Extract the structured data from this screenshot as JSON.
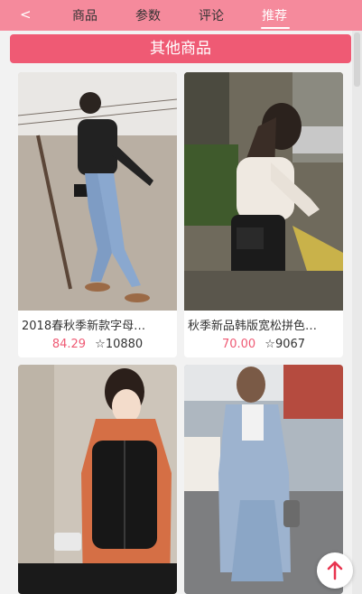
{
  "nav": {
    "back_label": "<",
    "tabs": [
      {
        "label": "商品"
      },
      {
        "label": "参数"
      },
      {
        "label": "评论"
      },
      {
        "label": "推荐",
        "active": true
      }
    ]
  },
  "section": {
    "title": "其他商品"
  },
  "products": [
    {
      "name": "2018春秋季新款字母…",
      "price": "84.29",
      "favorites": "10880"
    },
    {
      "name": "秋季新品韩版宽松拼色…",
      "price": "70.00",
      "favorites": "9067"
    },
    {
      "name": "",
      "price": "",
      "favorites": ""
    },
    {
      "name": "",
      "price": "",
      "favorites": ""
    }
  ],
  "icons": {
    "favorite": "star-outline-icon",
    "scroll_top": "arrow-up-icon"
  },
  "colors": {
    "nav_bg": "#f58a9c",
    "accent": "#ef5a74",
    "fab_arrow": "#e8344f"
  }
}
